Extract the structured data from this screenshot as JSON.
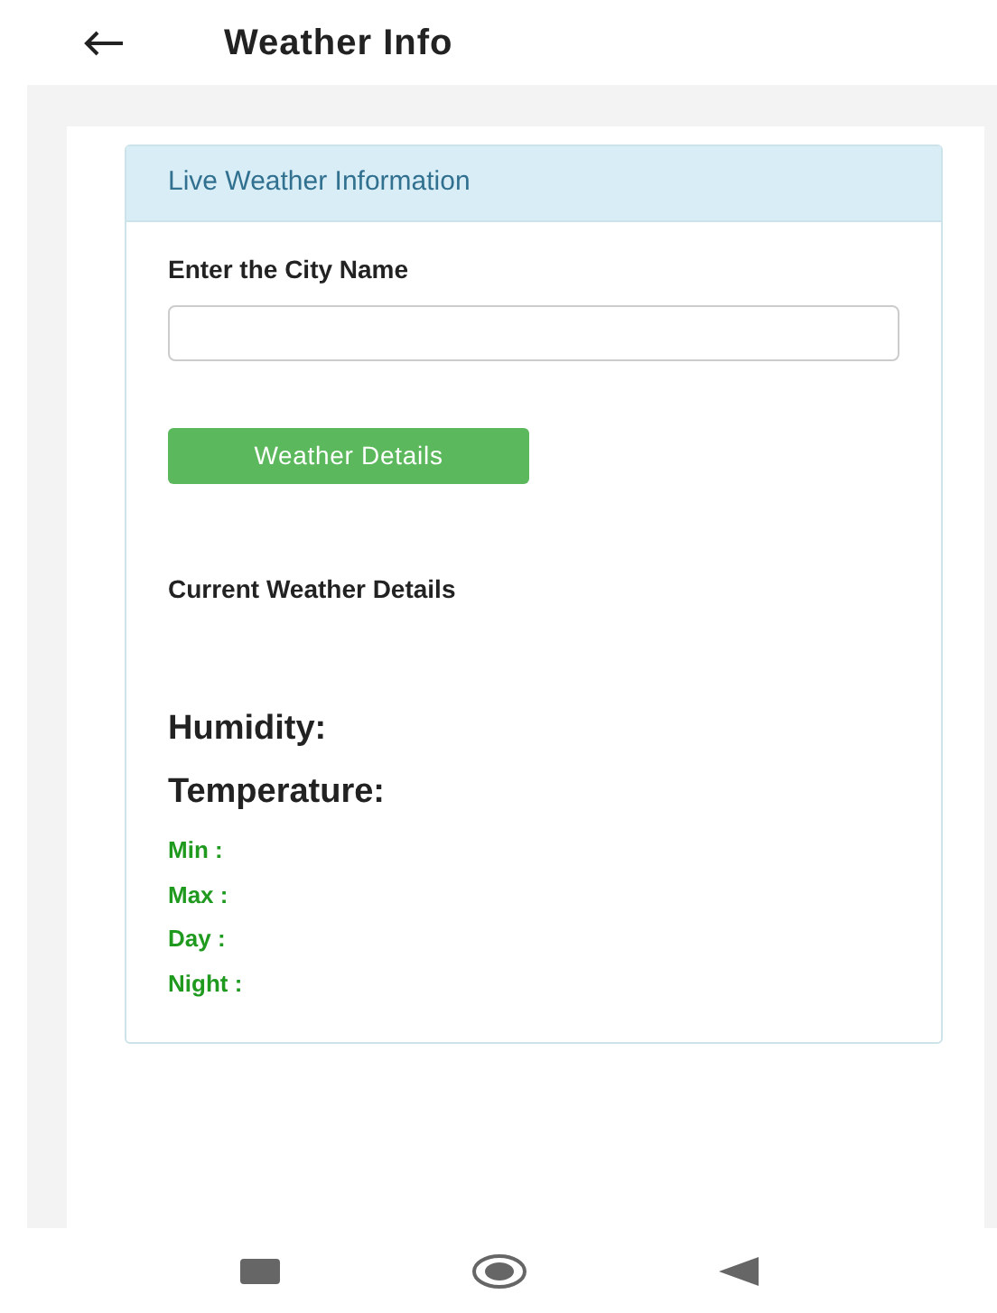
{
  "app_bar": {
    "title": "Weather Info"
  },
  "card": {
    "heading": "Live Weather Information",
    "city_label": "Enter the City Name",
    "button": "Weather Details",
    "section_title": "Current Weather Details",
    "humidity_label": "Humidity:",
    "temperature_label": "Temperature:",
    "temperature_rows": [
      "Min :",
      "Max :",
      "Day :",
      "Night :"
    ]
  }
}
